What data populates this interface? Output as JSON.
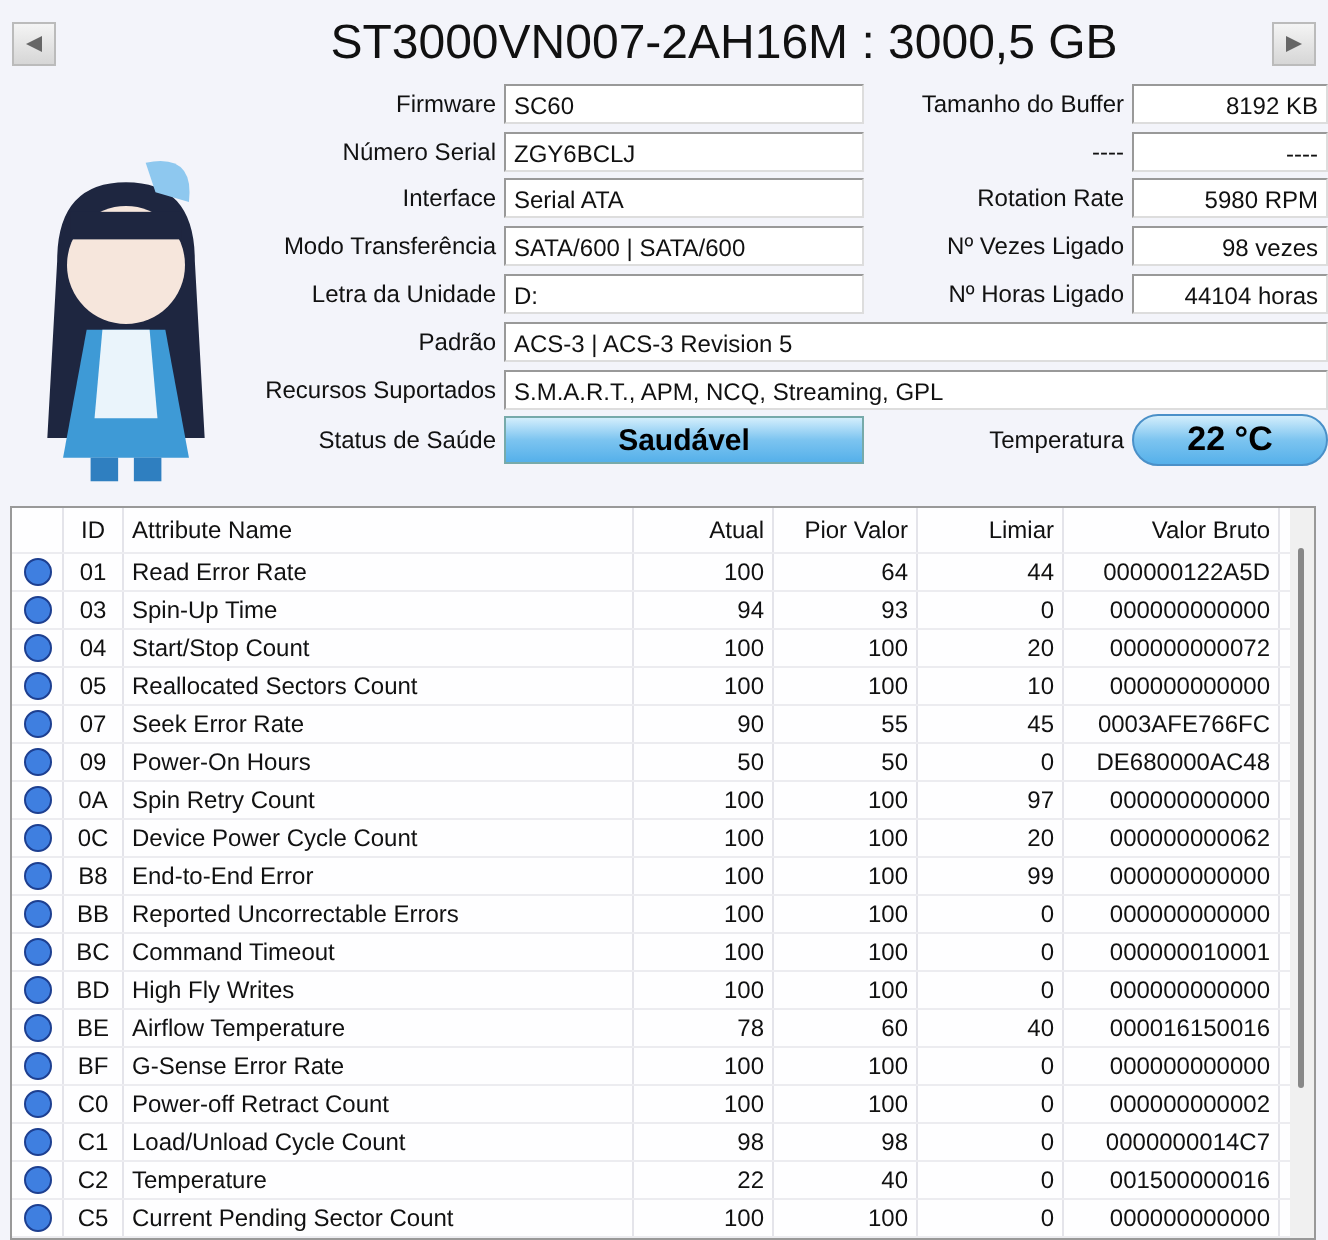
{
  "title": "ST3000VN007-2AH16M : 3000,5 GB",
  "info_left": [
    {
      "label": "Firmware",
      "value": "SC60"
    },
    {
      "label": "Número Serial",
      "value": "ZGY6BCLJ"
    },
    {
      "label": "Interface",
      "value": "Serial ATA"
    },
    {
      "label": "Modo Transferência",
      "value": "SATA/600 | SATA/600"
    },
    {
      "label": "Letra da Unidade",
      "value": "D:"
    }
  ],
  "info_right": [
    {
      "label": "Tamanho do Buffer",
      "value": "8192 KB"
    },
    {
      "label": "----",
      "value": "----"
    },
    {
      "label": "Rotation Rate",
      "value": "5980 RPM"
    },
    {
      "label": "Nº Vezes Ligado",
      "value": "98 vezes"
    },
    {
      "label": "Nº Horas Ligado",
      "value": "44104 horas"
    }
  ],
  "info_wide": [
    {
      "label": "Padrão",
      "value": "ACS-3 | ACS-3 Revision 5"
    },
    {
      "label": "Recursos Suportados",
      "value": "S.M.A.R.T., APM, NCQ, Streaming, GPL"
    }
  ],
  "health": {
    "label": "Status de Saúde",
    "value": "Saudável"
  },
  "temperature": {
    "label": "Temperatura",
    "value": "22 °C"
  },
  "table": {
    "columns": [
      "ID",
      "Attribute Name",
      "Atual",
      "Pior Valor",
      "Limiar",
      "Valor Bruto"
    ],
    "rows": [
      {
        "color": "#3f7fe0",
        "cells": [
          "01",
          "Read Error Rate",
          "100",
          "64",
          "44",
          "000000122A5D"
        ]
      },
      {
        "color": "#3f7fe0",
        "cells": [
          "03",
          "Spin-Up Time",
          "94",
          "93",
          "0",
          "000000000000"
        ]
      },
      {
        "color": "#3f7fe0",
        "cells": [
          "04",
          "Start/Stop Count",
          "100",
          "100",
          "20",
          "000000000072"
        ]
      },
      {
        "color": "#3f7fe0",
        "cells": [
          "05",
          "Reallocated Sectors Count",
          "100",
          "100",
          "10",
          "000000000000"
        ]
      },
      {
        "color": "#3f7fe0",
        "cells": [
          "07",
          "Seek Error Rate",
          "90",
          "55",
          "45",
          "0003AFE766FC"
        ]
      },
      {
        "color": "#3f7fe0",
        "cells": [
          "09",
          "Power-On Hours",
          "50",
          "50",
          "0",
          "DE680000AC48"
        ]
      },
      {
        "color": "#3f7fe0",
        "cells": [
          "0A",
          "Spin Retry Count",
          "100",
          "100",
          "97",
          "000000000000"
        ]
      },
      {
        "color": "#3f7fe0",
        "cells": [
          "0C",
          "Device Power Cycle Count",
          "100",
          "100",
          "20",
          "000000000062"
        ]
      },
      {
        "color": "#3f7fe0",
        "cells": [
          "B8",
          "End-to-End Error",
          "100",
          "100",
          "99",
          "000000000000"
        ]
      },
      {
        "color": "#3f7fe0",
        "cells": [
          "BB",
          "Reported Uncorrectable Errors",
          "100",
          "100",
          "0",
          "000000000000"
        ]
      },
      {
        "color": "#3f7fe0",
        "cells": [
          "BC",
          "Command Timeout",
          "100",
          "100",
          "0",
          "000000010001"
        ]
      },
      {
        "color": "#3f7fe0",
        "cells": [
          "BD",
          "High Fly Writes",
          "100",
          "100",
          "0",
          "000000000000"
        ]
      },
      {
        "color": "#3f7fe0",
        "cells": [
          "BE",
          "Airflow Temperature",
          "78",
          "60",
          "40",
          "000016150016"
        ]
      },
      {
        "color": "#3f7fe0",
        "cells": [
          "BF",
          "G-Sense Error Rate",
          "100",
          "100",
          "0",
          "000000000000"
        ]
      },
      {
        "color": "#3f7fe0",
        "cells": [
          "C0",
          "Power-off Retract Count",
          "100",
          "100",
          "0",
          "000000000002"
        ]
      },
      {
        "color": "#3f7fe0",
        "cells": [
          "C1",
          "Load/Unload Cycle Count",
          "98",
          "98",
          "0",
          "0000000014C7"
        ]
      },
      {
        "color": "#3f7fe0",
        "cells": [
          "C2",
          "Temperature",
          "22",
          "40",
          "0",
          "001500000016"
        ]
      },
      {
        "color": "#3f7fe0",
        "cells": [
          "C5",
          "Current Pending Sector Count",
          "100",
          "100",
          "0",
          "000000000000"
        ]
      }
    ]
  }
}
